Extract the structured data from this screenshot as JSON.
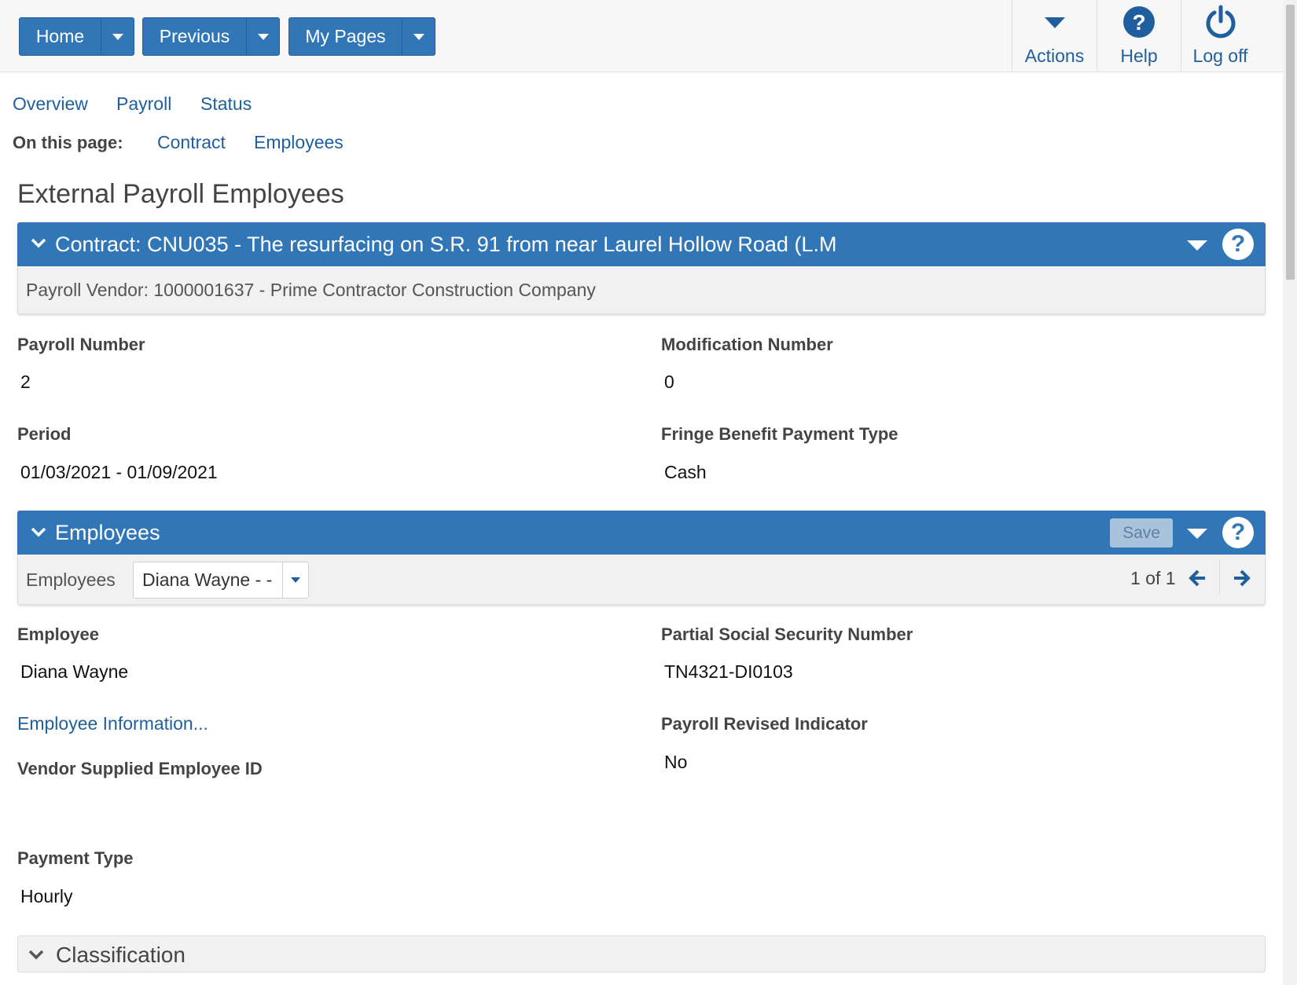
{
  "nav": {
    "home": "Home",
    "previous": "Previous",
    "my_pages": "My Pages",
    "actions": "Actions",
    "help": "Help",
    "log_off": "Log off"
  },
  "tabs": [
    "Overview",
    "Payroll",
    "Status"
  ],
  "on_this_page": {
    "label": "On this page:",
    "links": [
      "Contract",
      "Employees"
    ]
  },
  "page_title": "External Payroll Employees",
  "contract_panel": {
    "title": "Contract: CNU035 - The resurfacing on S.R. 91 from near Laurel Hollow Road (L.M",
    "subtitle": "Payroll Vendor: 1000001637 - Prime Contractor Construction Company"
  },
  "payroll_fields": {
    "payroll_number_label": "Payroll Number",
    "payroll_number": "2",
    "modification_number_label": "Modification Number",
    "modification_number": "0",
    "period_label": "Period",
    "period": "01/03/2021 - 01/09/2021",
    "fringe_label": "Fringe Benefit Payment Type",
    "fringe": "Cash"
  },
  "employees_panel": {
    "title": "Employees",
    "save": "Save",
    "selector_label": "Employees",
    "selected": "Diana Wayne - -",
    "pager": "1 of 1"
  },
  "employee_fields": {
    "employee_label": "Employee",
    "employee": "Diana Wayne",
    "ssn_label": "Partial Social Security Number",
    "ssn": "TN4321-DI0103",
    "info_link": "Employee Information...",
    "revised_label": "Payroll Revised Indicator",
    "revised": "No",
    "vendor_id_label": "Vendor Supplied Employee ID",
    "payment_type_label": "Payment Type",
    "payment_type": "Hourly"
  },
  "classification": {
    "title": "Classification"
  },
  "colors": {
    "primary": "#3177b8",
    "link": "#1f5f9e"
  }
}
